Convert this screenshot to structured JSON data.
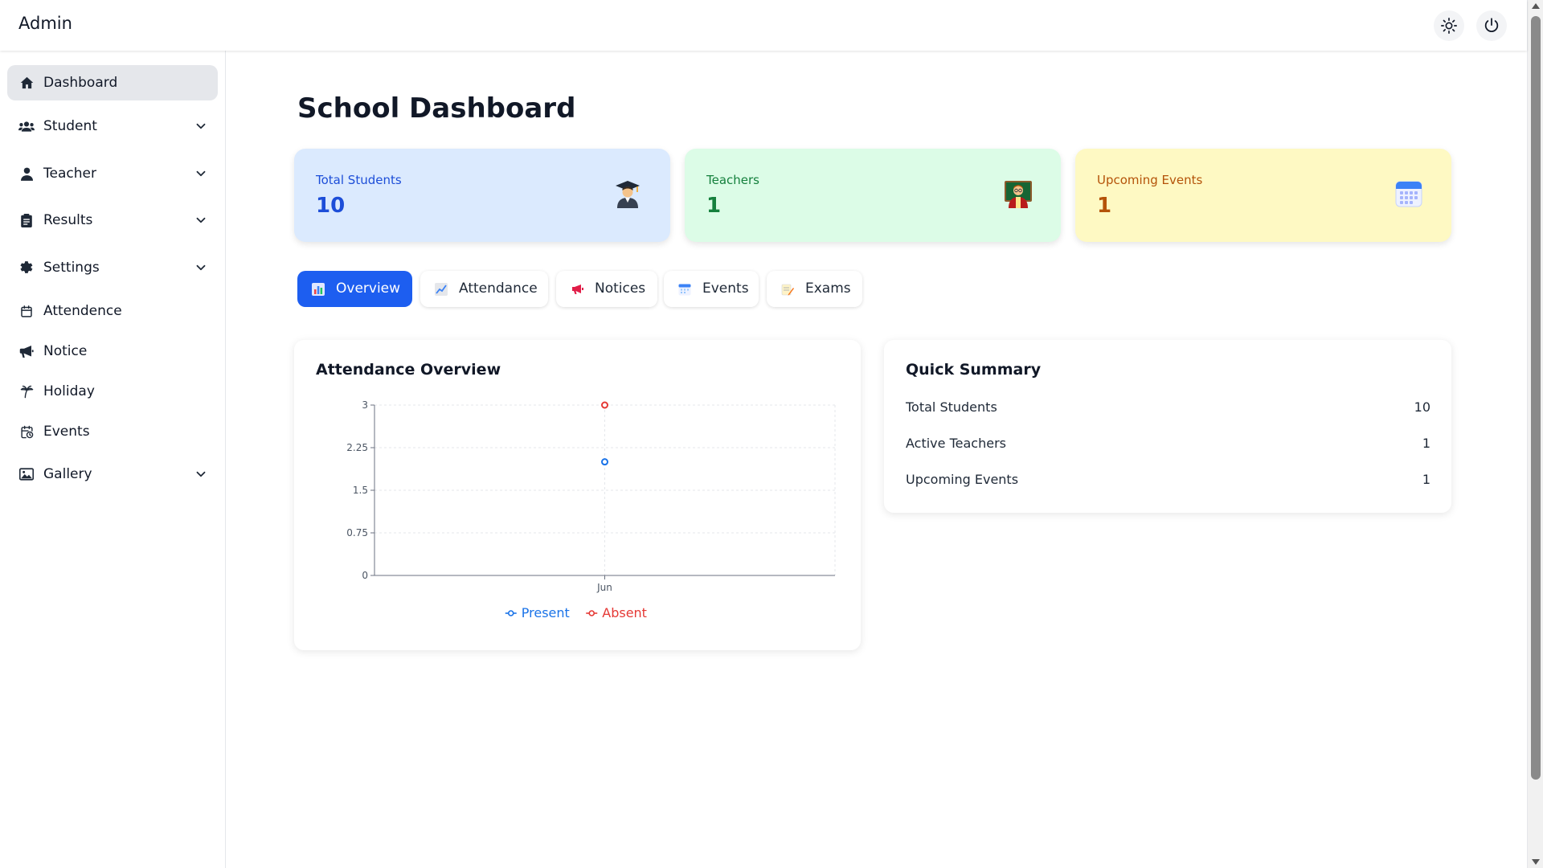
{
  "app": {
    "brand": "Admin"
  },
  "header": {
    "theme_icon": "sun-icon",
    "power_icon": "power-icon"
  },
  "sidebar": {
    "items": [
      {
        "label": "Dashboard",
        "icon": "home-icon",
        "active": true,
        "expandable": false
      },
      {
        "label": "Student",
        "icon": "users-icon",
        "active": false,
        "expandable": true
      },
      {
        "label": "Teacher",
        "icon": "user-icon",
        "active": false,
        "expandable": true
      },
      {
        "label": "Results",
        "icon": "clipboard-icon",
        "active": false,
        "expandable": true
      },
      {
        "label": "Settings",
        "icon": "gear-icon",
        "active": false,
        "expandable": true
      },
      {
        "label": "Attendence",
        "icon": "calendar-icon",
        "active": false,
        "expandable": false
      },
      {
        "label": "Notice",
        "icon": "megaphone-icon",
        "active": false,
        "expandable": false
      },
      {
        "label": "Holiday",
        "icon": "palm-tree-icon",
        "active": false,
        "expandable": false
      },
      {
        "label": "Events",
        "icon": "calendar-clock-icon",
        "active": false,
        "expandable": false
      },
      {
        "label": "Gallery",
        "icon": "image-icon",
        "active": false,
        "expandable": true
      }
    ]
  },
  "main": {
    "title": "School Dashboard",
    "stats": [
      {
        "label": "Total Students",
        "value": "10",
        "icon": "graduate-icon",
        "bg": "#dbeafe",
        "color": "#1d4ed8"
      },
      {
        "label": "Teachers",
        "value": "1",
        "icon": "teacher-icon",
        "bg": "#dcfce7",
        "color": "#15803d"
      },
      {
        "label": "Upcoming Events",
        "value": "1",
        "icon": "calendar-icon",
        "bg": "#fef9c3",
        "color": "#b45309"
      }
    ],
    "tabs": [
      {
        "label": "Overview",
        "icon": "bar-chart-icon",
        "active": true
      },
      {
        "label": "Attendance",
        "icon": "line-chart-icon",
        "active": false
      },
      {
        "label": "Notices",
        "icon": "megaphone-icon",
        "active": false
      },
      {
        "label": "Events",
        "icon": "calendar-icon",
        "active": false
      },
      {
        "label": "Exams",
        "icon": "memo-icon",
        "active": false
      }
    ],
    "attendance_card": {
      "title": "Attendance Overview"
    },
    "summary_card": {
      "title": "Quick Summary",
      "rows": [
        {
          "label": "Total Students",
          "value": "10"
        },
        {
          "label": "Active Teachers",
          "value": "1"
        },
        {
          "label": "Upcoming Events",
          "value": "1"
        }
      ]
    }
  },
  "colors": {
    "accent": "#1d5ef0",
    "present": "#1a73e8",
    "absent": "#e53935"
  },
  "chart_data": {
    "type": "line",
    "title": "Attendance Overview",
    "categories": [
      "Jun"
    ],
    "series": [
      {
        "name": "Present",
        "values": [
          2
        ],
        "color": "#1a73e8"
      },
      {
        "name": "Absent",
        "values": [
          3
        ],
        "color": "#e53935"
      }
    ],
    "yticks": [
      "0",
      "0.75",
      "1.5",
      "2.25",
      "3"
    ],
    "ylim": [
      0,
      3
    ],
    "xlabel": "",
    "ylabel": "",
    "grid": true,
    "legend_position": "bottom"
  }
}
